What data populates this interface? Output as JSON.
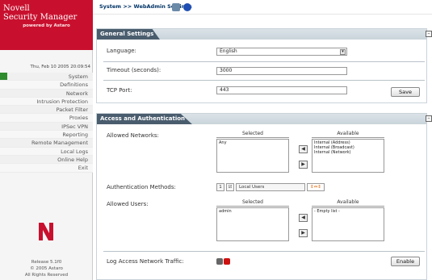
{
  "brand": {
    "line1": "Novell",
    "line2": "Security Manager",
    "powered": "powered by Astaro"
  },
  "datetime": "Thu, Feb 10 2005 20:09:54",
  "nav": [
    {
      "label": "System",
      "active": true
    },
    {
      "label": "Definitions",
      "active": false
    },
    {
      "label": "Network",
      "active": false
    },
    {
      "label": "Intrusion Protection",
      "active": false
    },
    {
      "label": "Packet Filter",
      "active": false
    },
    {
      "label": "Proxies",
      "active": false
    },
    {
      "label": "IPSec VPN",
      "active": false
    },
    {
      "label": "Reporting",
      "active": false
    },
    {
      "label": "Remote Management",
      "active": false
    },
    {
      "label": "Local Logs",
      "active": false
    },
    {
      "label": "Online Help",
      "active": false
    },
    {
      "label": "Exit",
      "active": false
    }
  ],
  "release": {
    "version": "Release 5.1f0",
    "copyright": "© 2005 Astaro",
    "rights": "All Rights Reserved"
  },
  "breadcrumb": {
    "root": "System",
    "sep": ">>",
    "page": "WebAdmin Settings"
  },
  "general": {
    "title": "General Settings",
    "language_label": "Language:",
    "language_value": "English",
    "timeout_label": "Timeout (seconds):",
    "timeout_value": "3000",
    "port_label": "TCP Port:",
    "port_value": "443",
    "save_label": "Save"
  },
  "access": {
    "title": "Access and Authentication",
    "networks_label": "Allowed Networks:",
    "selected_header": "Selected",
    "available_header": "Available",
    "networks_selected": [
      "Any"
    ],
    "networks_available": [
      "Internal (Address)",
      "Internal (Broadcast)",
      "Internal (Network)"
    ],
    "auth_label": "Authentication Methods:",
    "auth_index": "1",
    "auth_method": "Local Users",
    "users_label": "Allowed Users:",
    "users_selected": [
      "admin"
    ],
    "users_available": [
      "- Empty list -"
    ],
    "log_label": "Log Access Network Traffic:",
    "enable_label": "Enable"
  },
  "colors": {
    "brand": "#c8102e",
    "panel_tab": "#4a5d6e",
    "active_nav": "#2e8b2e"
  }
}
